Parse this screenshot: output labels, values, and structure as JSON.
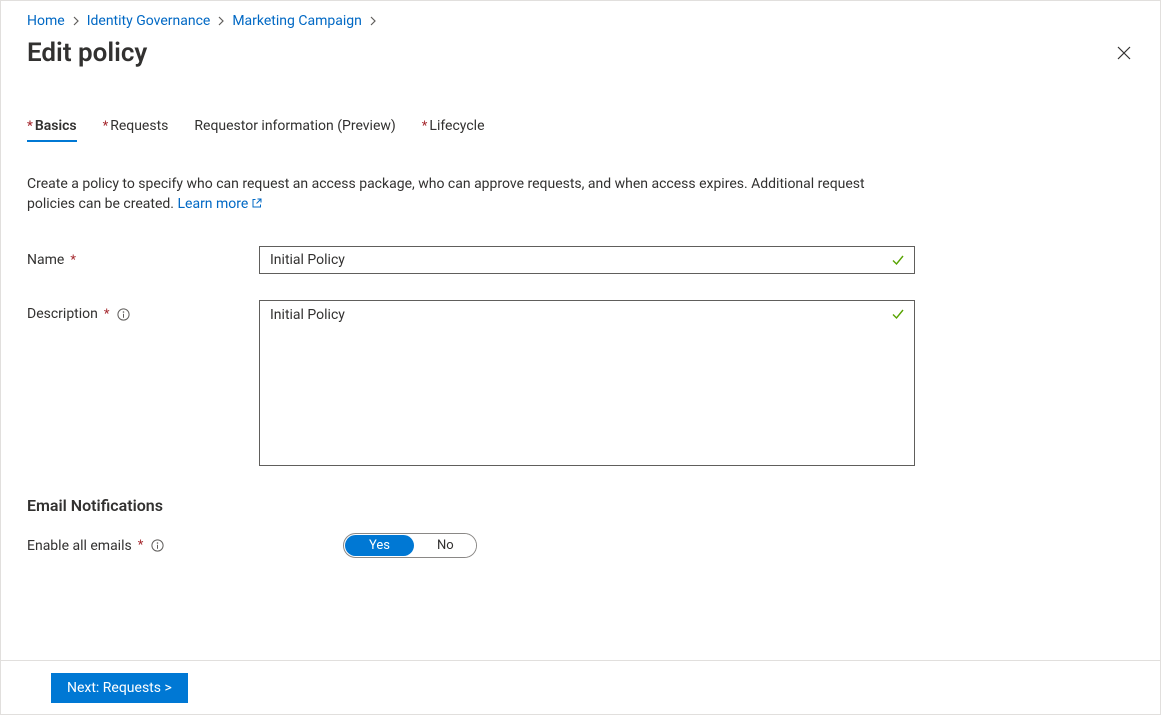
{
  "breadcrumb": {
    "items": [
      "Home",
      "Identity Governance",
      "Marketing Campaign"
    ]
  },
  "page": {
    "title": "Edit policy"
  },
  "tabs": [
    {
      "label": "Basics",
      "required": true,
      "active": true
    },
    {
      "label": "Requests",
      "required": true,
      "active": false
    },
    {
      "label": "Requestor information (Preview)",
      "required": false,
      "active": false
    },
    {
      "label": "Lifecycle",
      "required": true,
      "active": false
    }
  ],
  "introText": "Create a policy to specify who can request an access package, who can approve requests, and when access expires. Additional request policies can be created.",
  "learnMoreLabel": "Learn more",
  "form": {
    "nameLabel": "Name",
    "nameValue": "Initial Policy",
    "descriptionLabel": "Description",
    "descriptionValue": "Initial Policy"
  },
  "emailSection": {
    "heading": "Email Notifications",
    "enableLabel": "Enable all emails",
    "optionYes": "Yes",
    "optionNo": "No",
    "selected": "Yes"
  },
  "footer": {
    "nextLabel": "Next: Requests >"
  }
}
